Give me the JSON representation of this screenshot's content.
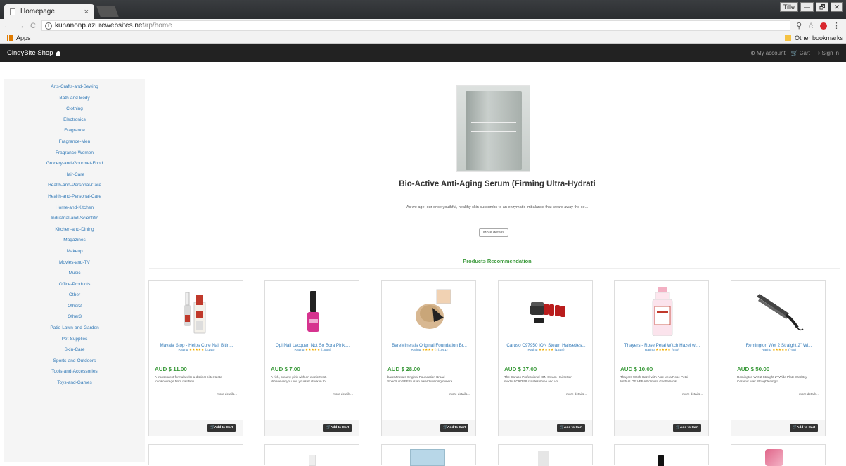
{
  "browser": {
    "tab_title": "Homepage",
    "tab_close": "×",
    "window_controls": [
      "Tille",
      "—",
      "🗗",
      "✕"
    ],
    "url_host": "kunanonp.azurewebsites.net",
    "url_path": "/rp/home",
    "bookmarks_apps": "Apps",
    "other_bookmarks": "Other bookmarks"
  },
  "site": {
    "brand": "CindyBite Shop",
    "nav_right": {
      "my_account": "My account",
      "cart": "Cart",
      "sign_in": "Sign in"
    }
  },
  "categories": [
    "Arts-Crafts-and-Sewing",
    "Bath-and-Body",
    "Clothing",
    "Electronics",
    "Fragrance",
    "Fragrance-Men",
    "Fragrance-Women",
    "Grocery-and-Gourmet-Food",
    "Hair-Care",
    "Health-and-Personal-Care",
    "Health-and-Personal-Care",
    "Home-and-Kitchen",
    "Industrial-and-Scientific",
    "Kitchen-and-Dining",
    "Magazines",
    "Makeup",
    "Movies-and-TV",
    "Music",
    "Office-Products",
    "Other",
    "Other2",
    "Other3",
    "Patio-Lawn-and-Garden",
    "Pet-Supplies",
    "Skin-Care",
    "Sports-and-Outdoors",
    "Tools-and-Accessories",
    "Toys-and-Games"
  ],
  "featured": {
    "title": "Bio-Active Anti-Aging Serum (Firming Ultra-Hydrati",
    "description": "As we age, our once youthful, healthy skin succumbs to an enzymatic imbalance that wears away the ce...",
    "more_details": "More details"
  },
  "recommendation_title": "Products Recommendation",
  "products": [
    {
      "name": "Mavala Stop - Helps Cure Nail Bitin...",
      "rating_label": "Rating",
      "stars": "★★★★★",
      "rating_count": "(2143)",
      "price": "AUD $ 11.00",
      "desc1": "A transparent formula with a distinct bitter taste",
      "desc2": "to discourage from nail bitin...",
      "more": "more details...",
      "cart": "Add to Cart"
    },
    {
      "name": "Opi Nail Lacquer, Not So Bora Pink,...",
      "rating_label": "Rating",
      "stars": "★★★★★",
      "rating_count": "(1558)",
      "price": "AUD $ 7.00",
      "desc1": "A rich, creamy pink with an exotic twist.",
      "desc2": "Whenever you find yourself stuck in th...",
      "more": "more details...",
      "cart": "Add to Cart"
    },
    {
      "name": "BareMinerals Original Foundation Br...",
      "rating_label": "Rating",
      "stars": "★★★★☆",
      "rating_count": "(1051)",
      "price": "AUD $ 28.00",
      "desc1": "bareMinerals Original Foundation Broad",
      "desc2": "Spectrum SPF15 is an award-winning minera...",
      "more": "more details...",
      "cart": "Add to Cart"
    },
    {
      "name": "Caruso C97950 ION Steam Hairsettes...",
      "rating_label": "Rating",
      "stars": "★★★★★",
      "rating_count": "(1548)",
      "price": "AUD $ 37.00",
      "desc1": "The Caruso Professional ION Steam Hairsetter",
      "desc2": "model #C97958 creates shine and vol...",
      "more": "more details...",
      "cart": "Add to Cart"
    },
    {
      "name": "Thayers - Rose Petal Witch Hazel wi...",
      "rating_label": "Rating",
      "stars": "★★★★★",
      "rating_count": "(649)",
      "price": "AUD $ 10.00",
      "desc1": "Thayers Witch Hazel with Aloe Vera Rose Petal",
      "desc2": "With ALOE VERA Formula Gentle Mois...",
      "more": "more details...",
      "cart": "Add to Cart"
    },
    {
      "name": "Remington Wet 2 Straight 2\" Wi...",
      "rating_label": "Rating",
      "stars": "★★★★★",
      "rating_count": "(795)",
      "price": "AUD $ 50.00",
      "desc1": "Remington Wet 2 Straight 2\" Wide Plate Wet/Dry",
      "desc2": "Ceramic Hair Straightening I...",
      "more": "more details...",
      "cart": "Add to Cart"
    }
  ]
}
